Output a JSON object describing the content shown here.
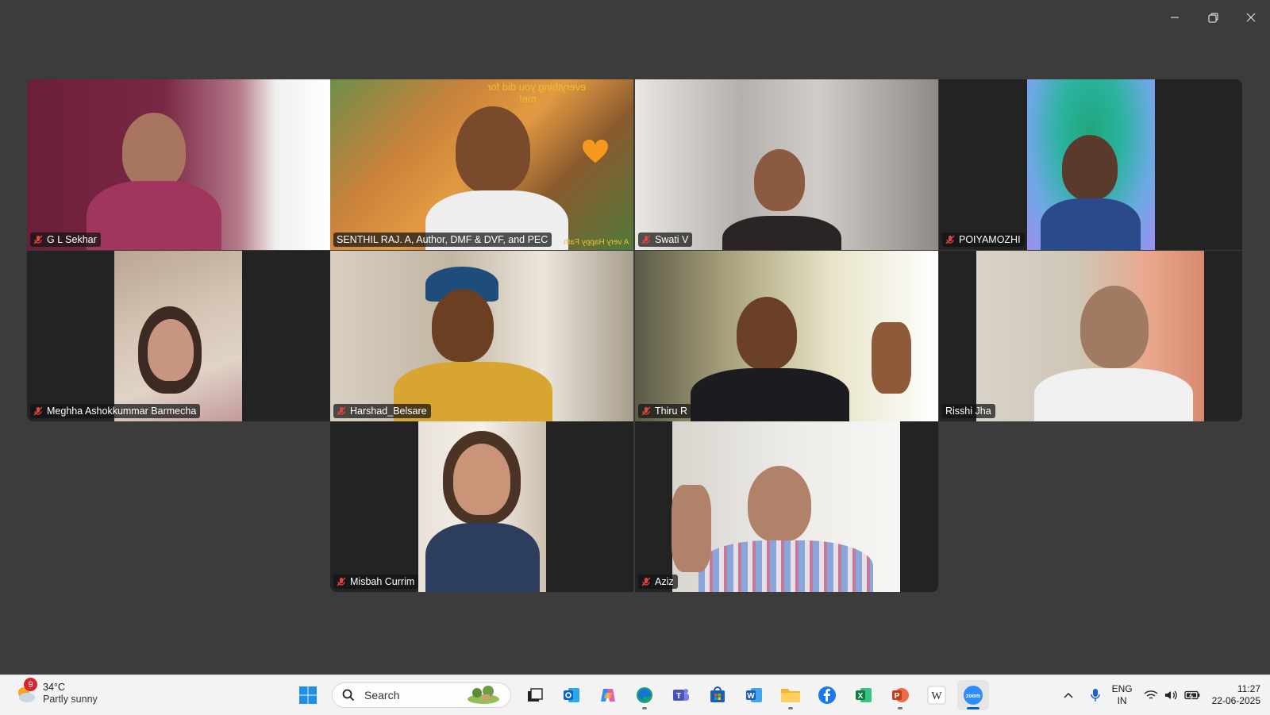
{
  "window": {
    "minimize_label": "—",
    "restore_label": "❐",
    "close_label": "✕"
  },
  "participants": [
    {
      "name": "G L Sekhar",
      "muted": true
    },
    {
      "name": "SENTHIL RAJ. A, Author, DMF & DVF, and PEC",
      "muted": false,
      "active": true
    },
    {
      "name": "Swati V",
      "muted": true
    },
    {
      "name": "POIYAMOZHI",
      "muted": true
    },
    {
      "name": "Meghha Ashokkummar Barmecha",
      "muted": true
    },
    {
      "name": "Harshad_Belsare",
      "muted": true
    },
    {
      "name": "Thiru R",
      "muted": true
    },
    {
      "name": "Risshi Jha",
      "muted": false
    },
    {
      "name": "Misbah Currim",
      "muted": true
    },
    {
      "name": "Aziz",
      "muted": true
    }
  ],
  "overlay": {
    "line1": "everything you did for",
    "line2": "me!",
    "line3": "A very Happy Fath"
  },
  "taskbar": {
    "weather": {
      "badge": "9",
      "temp": "34°C",
      "condition": "Partly sunny"
    },
    "search": {
      "placeholder": "Search"
    },
    "language": {
      "line1": "ENG",
      "line2": "IN"
    },
    "clock": {
      "time": "11:27",
      "date": "22-06-2025"
    }
  },
  "colors": {
    "active_speaker": "#22d46a",
    "mute_icon": "#e0443e",
    "taskbar_accent": "#0067c0"
  }
}
